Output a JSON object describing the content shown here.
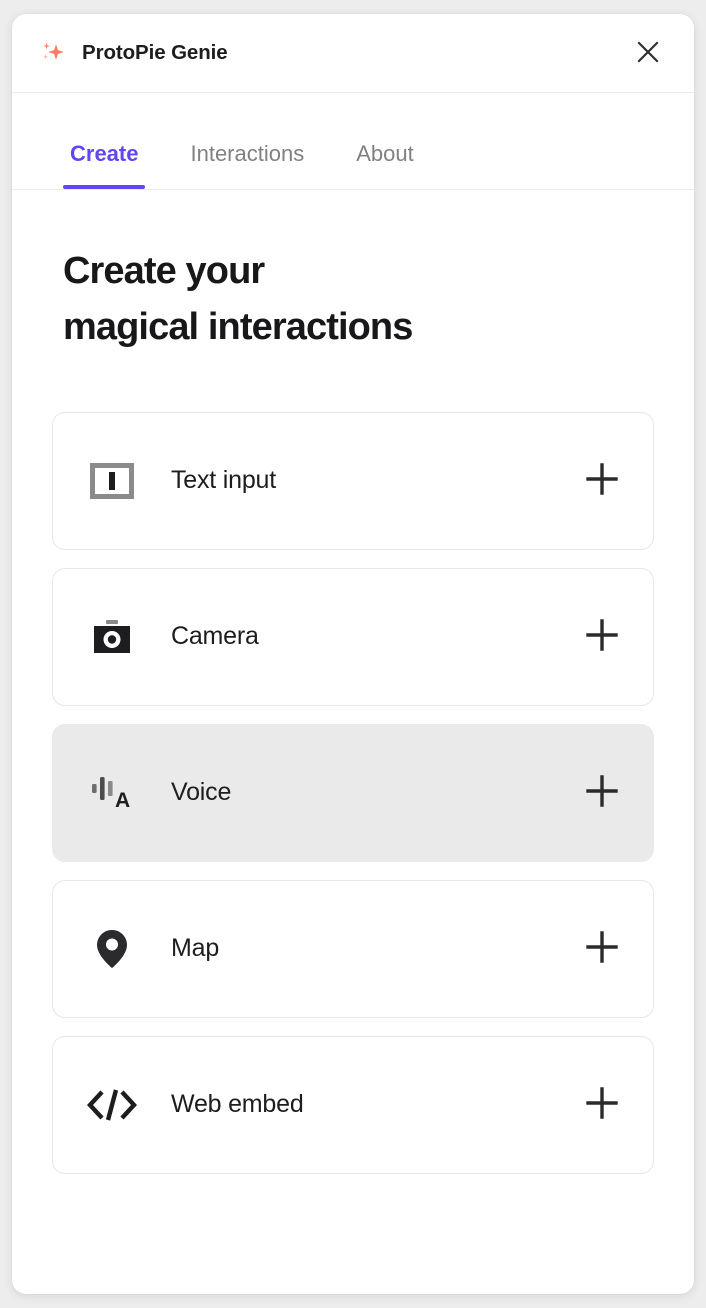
{
  "window": {
    "header": {
      "logo_icon": "sparkle-icon",
      "title": "ProtoPie Genie",
      "close_icon": "close-icon"
    },
    "tabs": [
      {
        "label": "Create",
        "active": true
      },
      {
        "label": "Interactions",
        "active": false
      },
      {
        "label": "About",
        "active": false
      }
    ]
  },
  "main": {
    "headline_line1": "Create your",
    "headline_line2": "magical interactions",
    "cards": [
      {
        "label": "Text input",
        "icon": "text-input-icon",
        "add_icon": "plus-icon",
        "highlighted": false
      },
      {
        "label": "Camera",
        "icon": "camera-icon",
        "add_icon": "plus-icon",
        "highlighted": false
      },
      {
        "label": "Voice",
        "icon": "voice-icon",
        "add_icon": "plus-icon",
        "highlighted": true
      },
      {
        "label": "Map",
        "icon": "map-pin-icon",
        "add_icon": "plus-icon",
        "highlighted": false
      },
      {
        "label": "Web embed",
        "icon": "web-embed-icon",
        "add_icon": "plus-icon",
        "highlighted": false
      }
    ]
  },
  "colors": {
    "accent_purple": "#6246f5",
    "logo_coral": "#fa7b62",
    "text_dark": "#1d1d1f",
    "text_muted": "#818181",
    "card_border": "#e7e7e7",
    "highlight_bg": "#eaeaea",
    "page_bg": "#ededed"
  }
}
